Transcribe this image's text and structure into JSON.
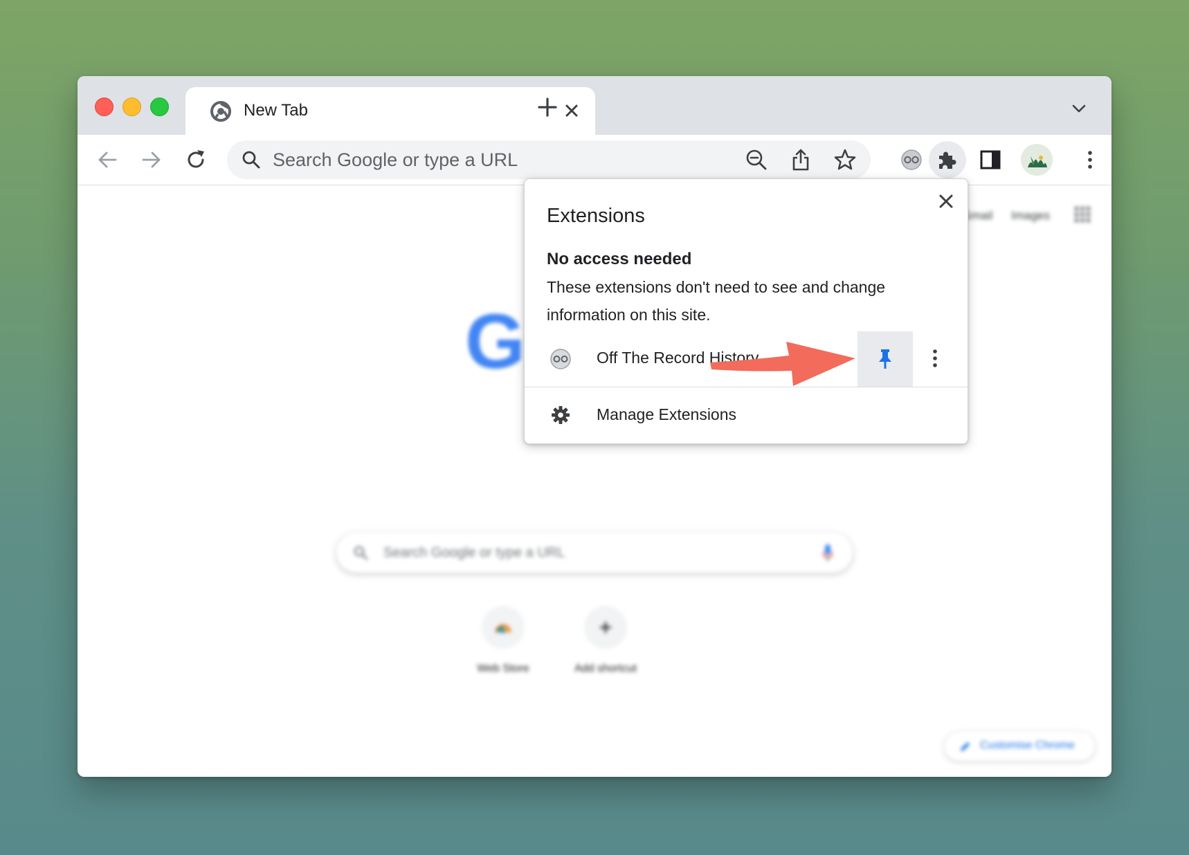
{
  "browser": {
    "tab": {
      "title": "New Tab",
      "favicon": "chrome-logo-icon"
    },
    "new_tab_icon": "plus-icon",
    "tab_search_icon": "chevron-down-icon"
  },
  "toolbar": {
    "back_icon": "arrow-left-icon",
    "forward_icon": "arrow-right-icon",
    "reload_icon": "reload-icon",
    "omnibox": {
      "placeholder": "Search Google or type a URL",
      "zoom_icon": "zoom-out-icon",
      "share_icon": "share-icon",
      "bookmark_icon": "star-icon"
    },
    "extension_icon": "off-the-record-icon",
    "extensions_menu_icon": "puzzle-icon",
    "side_panel_icon": "side-panel-icon",
    "profile_icon": "avatar",
    "menu_icon": "kebab-icon"
  },
  "new_tab_page": {
    "top_links": [
      "Gmail",
      "Images"
    ],
    "logo_letter": "G",
    "search_placeholder": "Search Google or type a URL",
    "shortcuts": [
      {
        "label": "Web Store"
      },
      {
        "label": "Add shortcut"
      }
    ],
    "customise_label": "Customise Chrome"
  },
  "extensions_popup": {
    "title": "Extensions",
    "section_heading": "No access needed",
    "section_description": "These extensions don't need to see and change information on this site.",
    "extensions": [
      {
        "name": "Off The Record History",
        "pinned": true
      }
    ],
    "manage_label": "Manage Extensions"
  },
  "colors": {
    "accent_blue": "#1a73e8",
    "annotation_arrow": "#f26b5b",
    "pin_button_bg": "#e8eaed",
    "tabstrip_bg": "#dee1e6"
  }
}
